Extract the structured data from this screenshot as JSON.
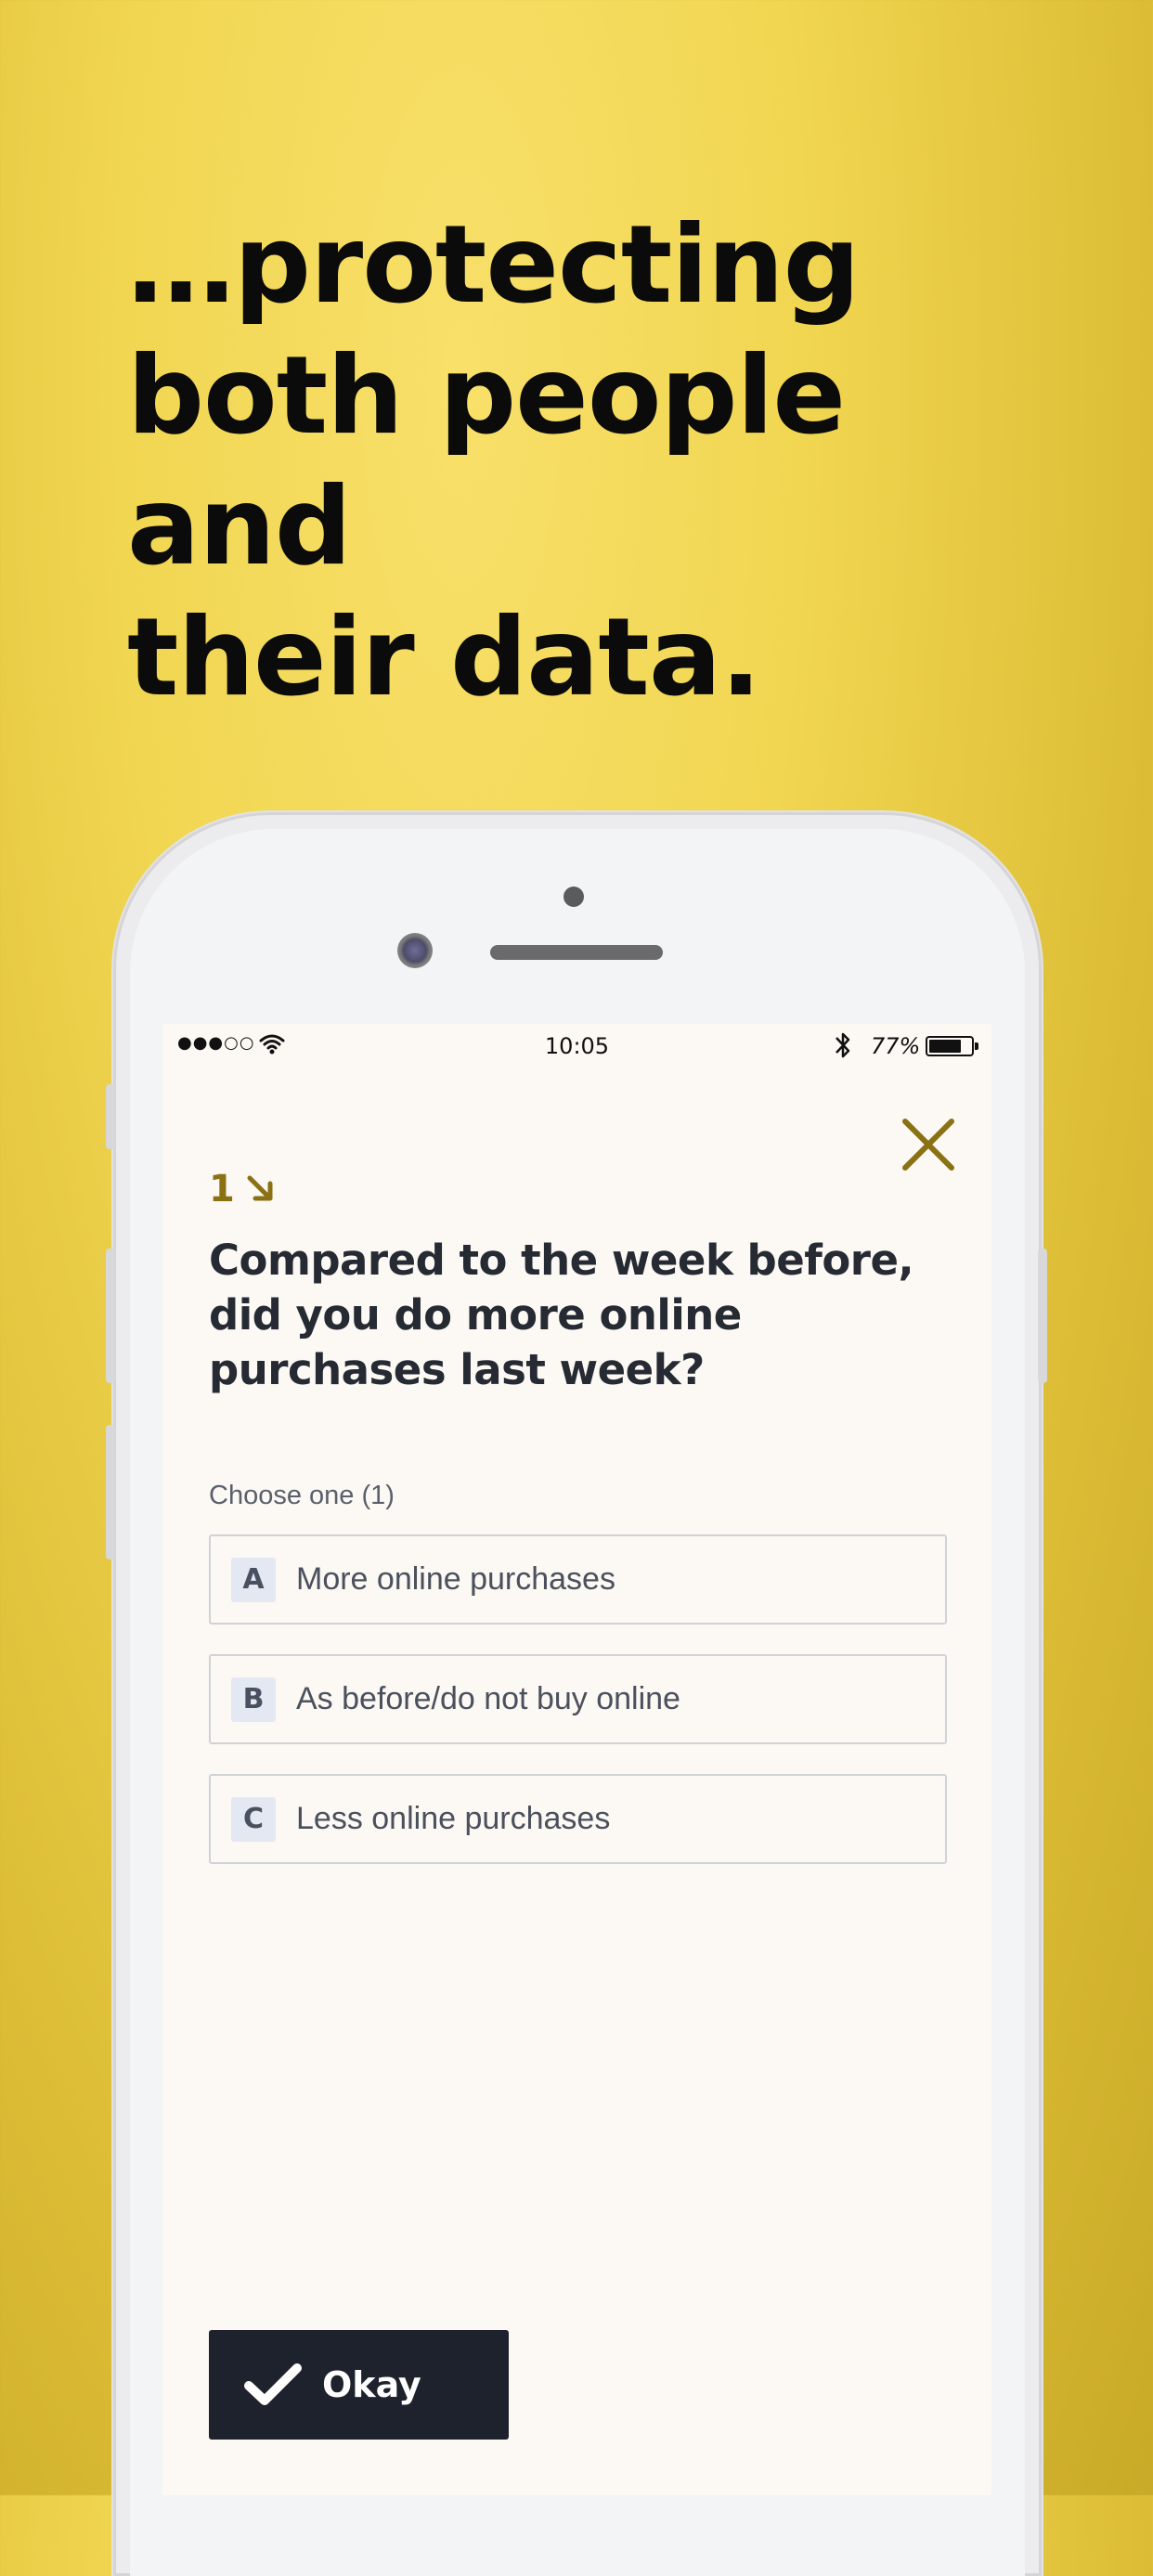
{
  "headline": {
    "lines": [
      "…protecting",
      "both people and",
      "their data."
    ]
  },
  "statusbar": {
    "signal": "●●●○○",
    "time": "10:05",
    "battery_pct": "77%",
    "battery_level": 0.77
  },
  "question": {
    "number": "1",
    "text": "Compared to the week before, did you do more online purchases last week?",
    "instruction": "Choose one (1)",
    "options": [
      {
        "key": "A",
        "label": "More online purchases"
      },
      {
        "key": "B",
        "label": "As before/do not buy online"
      },
      {
        "key": "C",
        "label": "Less online purchases"
      }
    ]
  },
  "actions": {
    "okay_label": "Okay"
  },
  "colors": {
    "accent": "#8a7113",
    "button_bg": "#1e222c",
    "background": "#f1d651"
  },
  "icons": {
    "close": "close-icon",
    "arrow": "arrow-down-right-icon",
    "check": "check-icon",
    "wifi": "wifi-icon",
    "bluetooth": "bluetooth-icon",
    "battery": "battery-icon"
  }
}
